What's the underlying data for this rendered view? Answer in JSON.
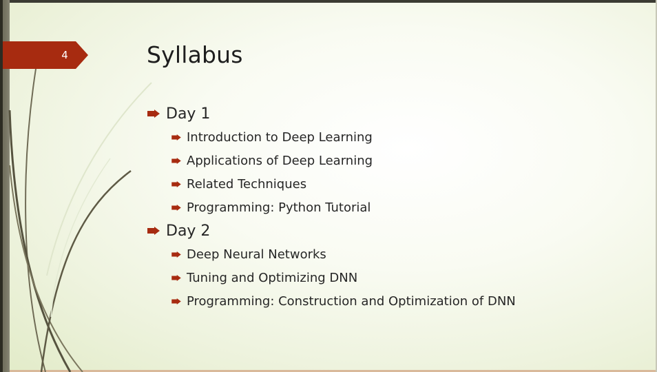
{
  "slide": {
    "number": "4",
    "title": "Syllabus",
    "accent_color": "#a72b10",
    "sections": [
      {
        "label": "Day 1",
        "items": [
          "Introduction to Deep Learning",
          "Applications of Deep Learning",
          "Related Techniques",
          "Programming: Python Tutorial"
        ]
      },
      {
        "label": "Day 2",
        "items": [
          "Deep Neural Networks",
          "Tuning and Optimizing DNN",
          "Programming: Construction and Optimization of DNN"
        ]
      }
    ]
  },
  "icons": {
    "bullet": "arrow-bullet-icon"
  }
}
